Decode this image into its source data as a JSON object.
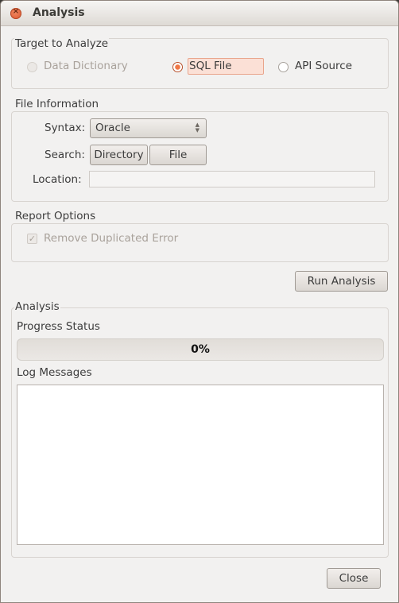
{
  "window": {
    "title": "Analysis",
    "close_icon": "close-icon"
  },
  "target": {
    "label": "Target to Analyze",
    "options": [
      {
        "label": "Data Dictionary",
        "state": "disabled",
        "checked": false
      },
      {
        "label": "SQL File",
        "state": "enabled",
        "checked": true
      },
      {
        "label": "API Source",
        "state": "enabled",
        "checked": false
      }
    ]
  },
  "file_info": {
    "label": "File Information",
    "syntax_label": "Syntax:",
    "syntax_value": "Oracle",
    "search_label": "Search:",
    "directory_button": "Directory",
    "file_button": "File",
    "location_label": "Location:",
    "location_value": ""
  },
  "report": {
    "label": "Report Options",
    "remove_duplicated": {
      "label": "Remove Duplicated Error",
      "checked": true,
      "disabled": true
    }
  },
  "run_button": "Run Analysis",
  "analysis": {
    "label": "Analysis",
    "progress_label": "Progress Status",
    "progress_text": "0%",
    "progress_value": 0,
    "log_label": "Log Messages",
    "log_text": ""
  },
  "close_button": "Close",
  "colors": {
    "accent": "#f07746",
    "highlight_bg": "#fbe0d6"
  }
}
